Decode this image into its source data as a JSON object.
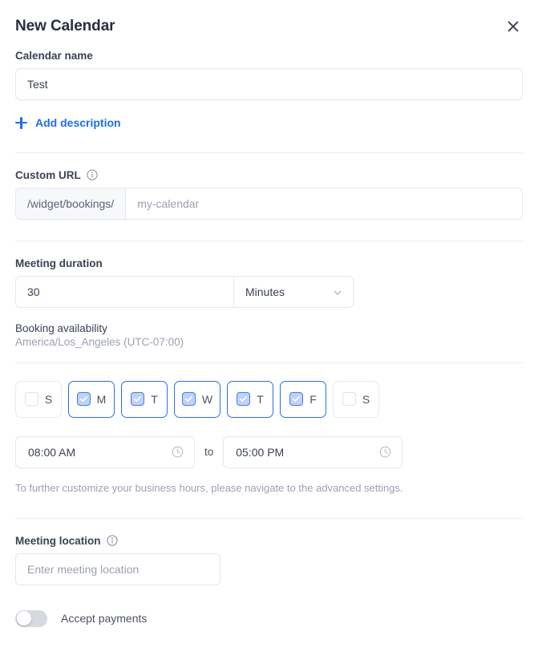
{
  "header": {
    "title": "New Calendar",
    "close_icon": "close-icon"
  },
  "calendar_name": {
    "label": "Calendar name",
    "value": "Test",
    "placeholder": ""
  },
  "add_description": {
    "label": "Add description",
    "icon": "plus-icon"
  },
  "custom_url": {
    "label": "Custom URL",
    "info_icon": "info-circle-icon",
    "prefix": "/widget/bookings/",
    "value": "",
    "placeholder": "my-calendar"
  },
  "meeting_duration": {
    "label": "Meeting duration",
    "value": "30",
    "unit": "Minutes",
    "chevron_icon": "chevron-down-icon"
  },
  "booking_availability": {
    "label": "Booking availability",
    "timezone": "America/Los_Angeles (UTC-07:00)",
    "days": [
      {
        "letter": "S",
        "name": "sunday",
        "checked": false
      },
      {
        "letter": "M",
        "name": "monday",
        "checked": true
      },
      {
        "letter": "T",
        "name": "tuesday",
        "checked": true
      },
      {
        "letter": "W",
        "name": "wednesday",
        "checked": true
      },
      {
        "letter": "T",
        "name": "thursday",
        "checked": true
      },
      {
        "letter": "F",
        "name": "friday",
        "checked": true
      },
      {
        "letter": "S",
        "name": "saturday",
        "checked": false
      }
    ],
    "start_time": "08:00 AM",
    "end_time": "05:00 PM",
    "to_label": "to",
    "clock_icon": "clock-icon",
    "hint": "To further customize your business hours, please navigate to the advanced settings."
  },
  "meeting_location": {
    "label": "Meeting location",
    "info_icon": "info-circle-icon",
    "value": "",
    "placeholder": "Enter meeting location"
  },
  "accept_payments": {
    "label": "Accept payments",
    "enabled": false
  },
  "colors": {
    "accent": "#1a6ef5",
    "checkbox_border": "#3d7ff0",
    "checkbox_fill": "#bed2f8",
    "chip_selected_border": "#2d6fe8",
    "text": "#3a4253",
    "muted": "#9aa1b0",
    "border": "#e3e6ec",
    "divider": "#eceef2",
    "toggle_off": "#d5d9e0"
  }
}
